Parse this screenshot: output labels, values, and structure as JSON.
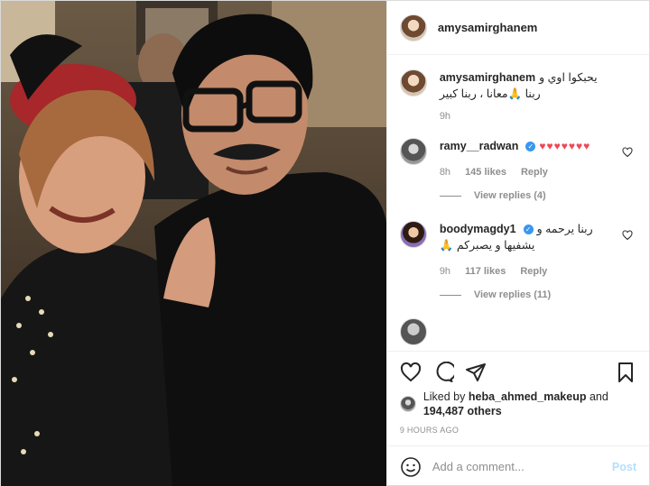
{
  "post": {
    "username": "amysamirghanem",
    "caption_user": "amysamirghanem",
    "caption_text": "يحبكوا اوي و ربنا 🙏معانا ، ربنا كبير",
    "caption_time": "9h",
    "comments": [
      {
        "user": "ramy__radwan",
        "verified": true,
        "text": "♥♥♥♥♥♥♥",
        "time": "8h",
        "likes": "145 likes",
        "reply": "Reply",
        "view_replies": "View replies (4)"
      },
      {
        "user": "boodymagdy1",
        "verified": true,
        "text": "ربنا يرحمه و يشفيها و يصبركم 🙏",
        "time": "9h",
        "likes": "117 likes",
        "reply": "Reply",
        "view_replies": "View replies (11)"
      }
    ],
    "liked_by_prefix": "Liked by",
    "liked_by_user": "heba_ahmed_makeup",
    "liked_by_and": "and",
    "liked_by_others": "194,487 others",
    "time_ago": "9 HOURS AGO",
    "add_comment_placeholder": "Add a comment...",
    "post_button": "Post"
  },
  "icons": {
    "like": "heart-icon",
    "comment": "comment-icon",
    "share": "paper-plane-icon",
    "save": "bookmark-icon",
    "emoji": "emoji-icon",
    "comment_like": "heart-outline-icon"
  },
  "colors": {
    "link_blue": "#3897f0",
    "heart_red": "#ed4956",
    "muted": "#8e8e8e",
    "post_disabled": "#b2dffc"
  }
}
